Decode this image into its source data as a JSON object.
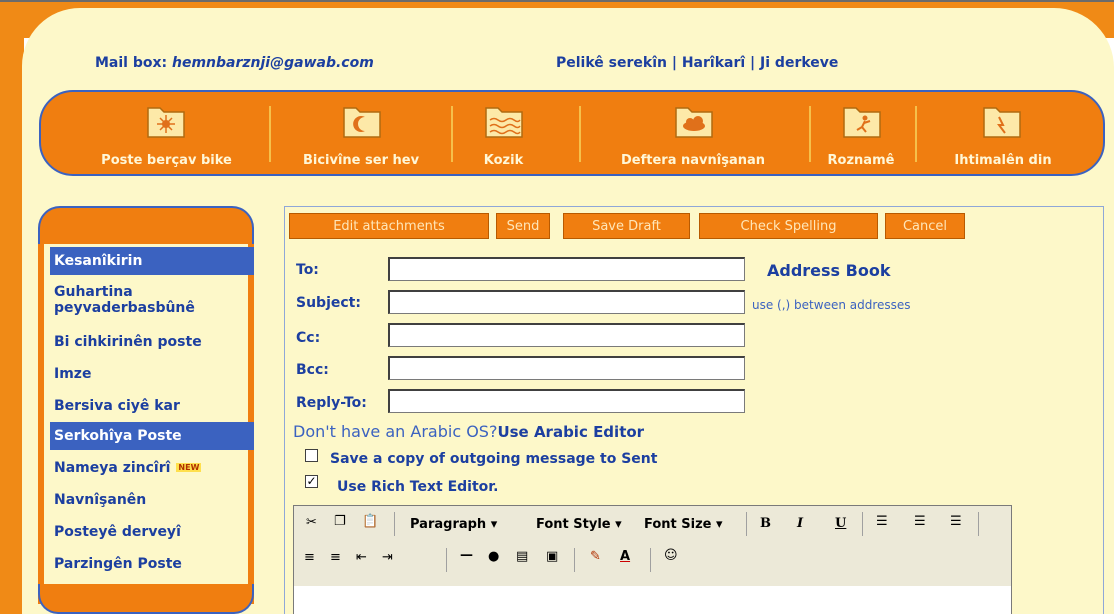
{
  "header": {
    "mailbox_label": "Mail box:",
    "mailbox_address": "hemnbarznji@gawab.com",
    "links": [
      "Pelikê serekîn",
      "Harîkarî",
      "Ji derkeve"
    ],
    "link_separator": "|"
  },
  "nav": [
    {
      "label": "Poste berçav bike",
      "icon": "sun-folder-icon"
    },
    {
      "label": "Bicivîne ser hev",
      "icon": "moon-folder-icon"
    },
    {
      "label": "Kozik",
      "icon": "wave-folder-icon"
    },
    {
      "label": "Deftera navnîşanan",
      "icon": "cloud-folder-icon"
    },
    {
      "label": "Roznamê",
      "icon": "figure-folder-icon"
    },
    {
      "label": "Ihtimalên din",
      "icon": "lightning-folder-icon"
    }
  ],
  "sidebar": {
    "items": [
      {
        "label": "Kesanîkirin",
        "active": true
      },
      {
        "label": "Guhartina peyvaderbasbûnê",
        "active": false
      },
      {
        "label": "Bi cihkirinên poste",
        "active": false
      },
      {
        "label": "Imze",
        "active": false
      },
      {
        "label": "Bersiva ciyê kar",
        "active": false
      },
      {
        "label": "Serkohîya Poste",
        "active": true
      },
      {
        "label": "Nameya zincîrî",
        "active": false,
        "badge": "NEW"
      },
      {
        "label": "Navnîşanên",
        "active": false
      },
      {
        "label": "Posteyê derveyî",
        "active": false
      },
      {
        "label": "Parzingên Poste",
        "active": false
      }
    ]
  },
  "toolbar": {
    "edit_attachments": "Edit attachments",
    "send": "Send",
    "save_draft": "Save Draft",
    "check_spelling": "Check Spelling",
    "cancel": "Cancel"
  },
  "form": {
    "to_label": "To:",
    "subject_label": "Subject:",
    "cc_label": "Cc:",
    "bcc_label": "Bcc:",
    "replyto_label": "Reply-To:",
    "to_value": "",
    "subject_value": "",
    "cc_value": "",
    "bcc_value": "",
    "replyto_value": "",
    "address_book": "Address Book",
    "address_hint": "use (,) between addresses",
    "arabic_question": "Don't have an Arabic OS?",
    "arabic_link": "Use Arabic Editor",
    "save_copy_label": "Save a copy of outgoing message to Sent",
    "save_copy_checked": false,
    "rich_text_label": "Use Rich Text Editor.",
    "rich_text_checked": true
  },
  "editor": {
    "paragraph": "Paragraph",
    "font_style": "Font Style",
    "font_size": "Font Size",
    "bold": "B",
    "italic": "I",
    "underline": "U"
  },
  "colors": {
    "orange": "#f07e10",
    "cream": "#fdf8c9",
    "blue": "#1c3fa0",
    "highlight": "#3b62c0"
  }
}
